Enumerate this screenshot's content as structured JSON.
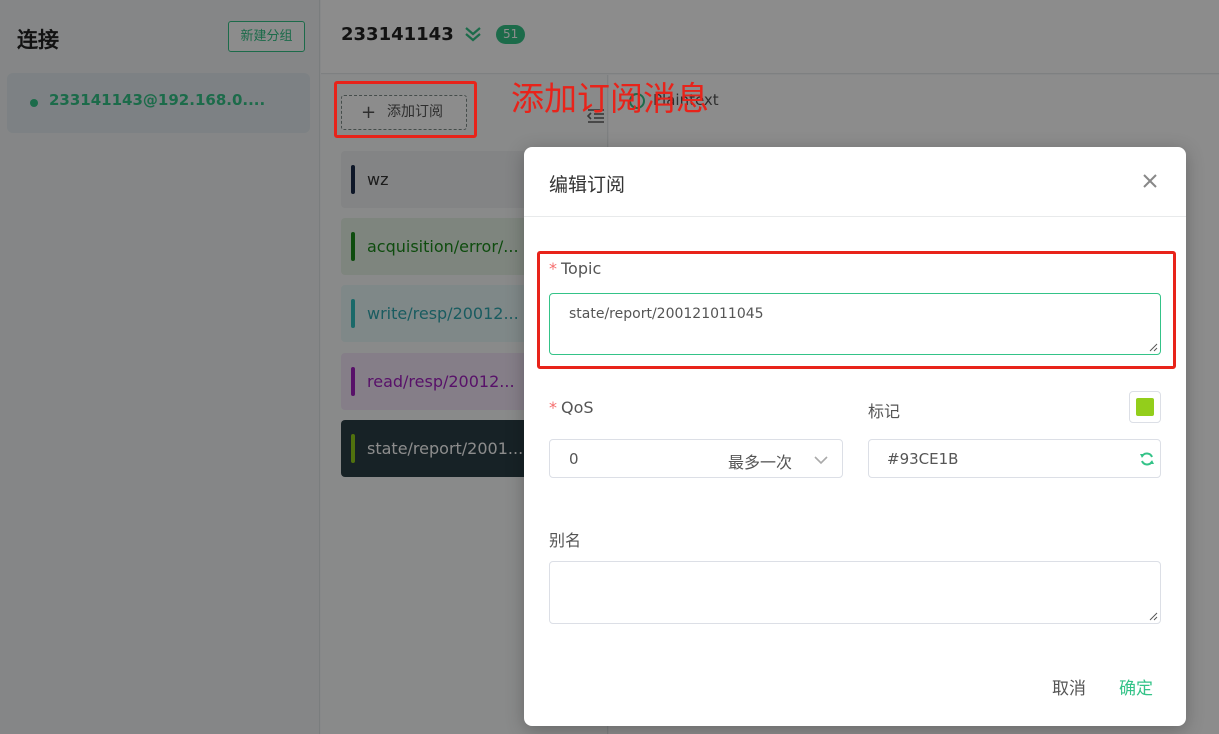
{
  "sidebar": {
    "title": "连接",
    "new_group_label": "新建分组",
    "connection": "233141143@192.168.0...."
  },
  "topbar": {
    "connection_title": "233141143",
    "message_count": "51"
  },
  "subscriptions": {
    "add_label": "添加订阅",
    "items": [
      {
        "topic": "wz",
        "color": "#1a2a4a"
      },
      {
        "topic": "acquisition/error/...",
        "color": "#1a8a1a"
      },
      {
        "topic": "write/resp/20012...",
        "color": "#30c0c0"
      },
      {
        "topic": "read/resp/20012...",
        "color": "#a020c0"
      },
      {
        "topic": "state/report/2001...",
        "color": "#93CE1B"
      }
    ]
  },
  "messages": {
    "payload_format": "Plaintext"
  },
  "annotation": {
    "text": "添加订阅消息"
  },
  "dialog": {
    "title": "编辑订阅",
    "topic_label": "Topic",
    "topic_value": "state/report/200121011045",
    "qos_label": "QoS",
    "qos_value": "0",
    "qos_desc": "最多一次",
    "tag_label": "标记",
    "tag_color": "#93CE1B",
    "alias_label": "别名",
    "alias_value": "",
    "cancel_label": "取消",
    "confirm_label": "确定"
  },
  "colors": {
    "accent": "#34c388",
    "annotation": "#e8231a",
    "required": "#f56c6c"
  }
}
